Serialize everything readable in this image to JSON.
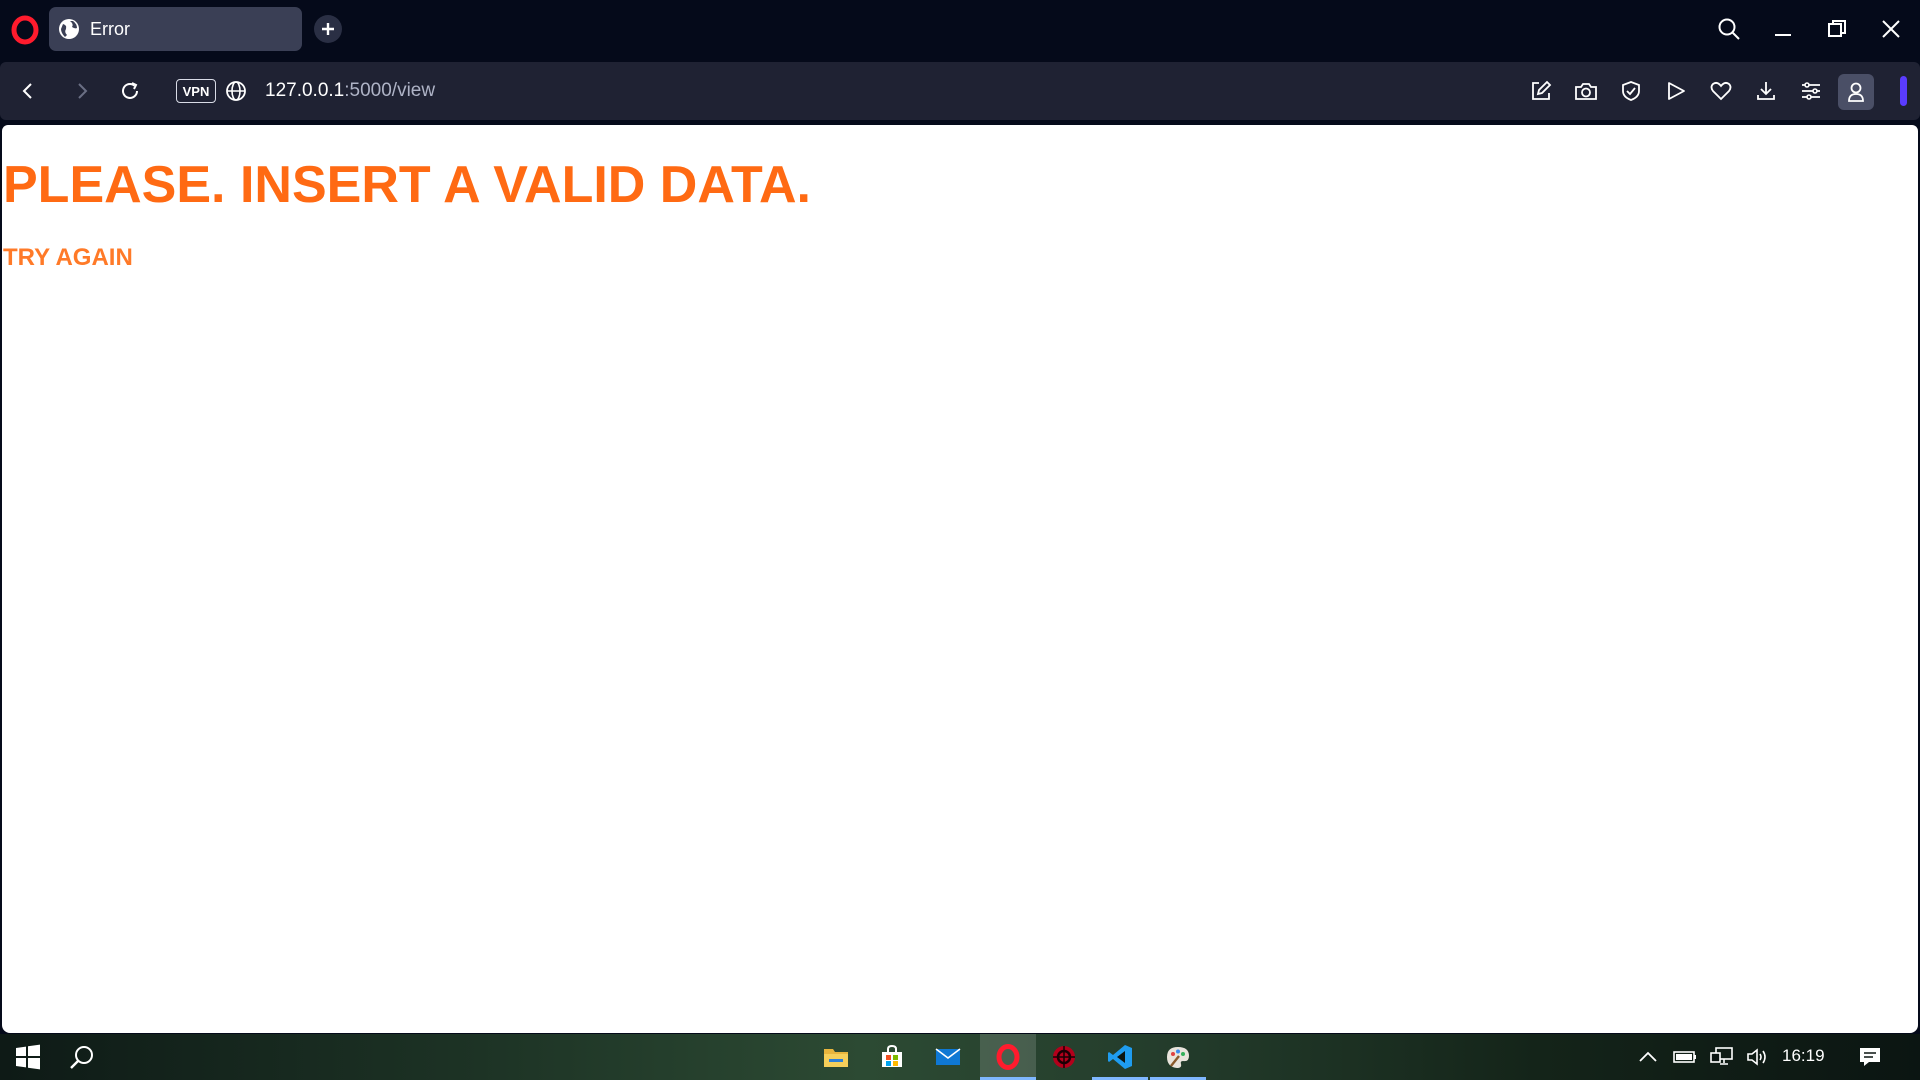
{
  "browser": {
    "tab": {
      "title": "Error",
      "icon": "globe-icon"
    },
    "address_bar": {
      "vpn_label": "VPN",
      "url_host": "127.0.0.1",
      "url_path": ":5000/view"
    },
    "toolbar_icons": [
      "snapshot-edit-icon",
      "camera-icon",
      "shield-icon",
      "send-icon",
      "heart-icon",
      "download-icon",
      "easy-setup-icon",
      "profile-icon"
    ],
    "accent_color": "#5a3cff"
  },
  "page": {
    "heading": "PLEASE. INSERT A VALID DATA.",
    "link_text": "TRY AGAIN",
    "heading_color": "#ff6a13"
  },
  "taskbar": {
    "pinned_apps": [
      "file-explorer-icon",
      "microsoft-store-icon",
      "mail-icon",
      "opera-icon",
      "gaming-app-icon",
      "vscode-icon",
      "paint-icon"
    ],
    "tray_icons": [
      "chevron-up-icon",
      "battery-icon",
      "network-icon",
      "volume-icon"
    ],
    "clock": "16:19"
  }
}
